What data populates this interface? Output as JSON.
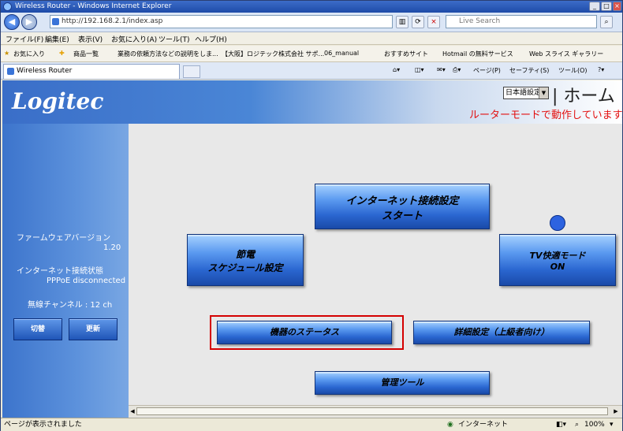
{
  "window": {
    "title": "Wireless Router - Windows Internet Explorer"
  },
  "address_bar": {
    "url": "http://192.168.2.1/index.asp",
    "search_placeholder": "Live Search"
  },
  "menu": [
    "ファイル(F)",
    "編集(E)",
    "表示(V)",
    "お気に入り(A)",
    "ツール(T)",
    "ヘルプ(H)"
  ],
  "favorites": {
    "label": "お気に入り",
    "items": [
      "商品一覧",
      "業務の依頼方法などの説明をしま...",
      "【大阪】ロジテック株式会社 サポ...",
      "06_manual",
      "おすすめサイト",
      "Hotmail の無料サービス",
      "Web スライス ギャラリー"
    ]
  },
  "tab": {
    "title": "Wireless Router"
  },
  "command_bar": {
    "page": "ページ(P)",
    "safety": "セーフティ(S)",
    "tools": "ツール(O)"
  },
  "router": {
    "logo": "Logitec",
    "language": "日本語設定",
    "home": "| ホーム |",
    "mode_message": "ルーターモードで動作しています。",
    "sidebar": {
      "firmware_label": "ファームウェアバージョン",
      "firmware_version": "1.20",
      "internet_label": "インターネット接続状態",
      "internet_status": "PPPoE disconnected",
      "channel": "無線チャンネル : 12 ch",
      "btn_switch": "切替",
      "btn_update": "更新"
    },
    "buttons": {
      "internet_setup_line1": "インターネット接続設定",
      "internet_setup_line2": "スタート",
      "eco_line1": "節電",
      "eco_line2": "スケジュール設定",
      "tv_line1": "TV快適モード",
      "tv_line2": "ON",
      "device_status": "機器のステータス",
      "advanced": "詳細設定（上級者向け）",
      "admin_tools": "管理ツール"
    }
  },
  "status_bar": {
    "left": "ページが表示されました",
    "zone": "インターネット",
    "zoom": "100%"
  }
}
